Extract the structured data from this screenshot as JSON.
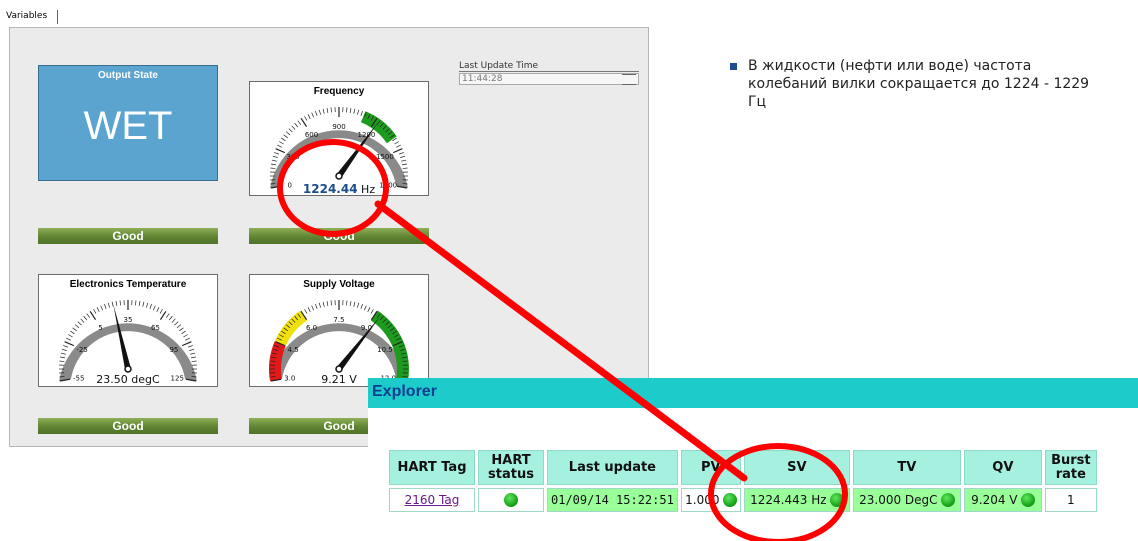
{
  "tabs": [
    {
      "label": "Variables"
    }
  ],
  "last_update": {
    "label": "Last Update Time",
    "value": "11:44:28"
  },
  "widgets": {
    "output_state": {
      "title": "Output State",
      "value": "WET",
      "status": "Good"
    },
    "frequency": {
      "title": "Frequency",
      "value": "1224.44",
      "unit": "Hz",
      "ticks": [
        "0",
        "300",
        "600",
        "900",
        "1200",
        "1500",
        "1800"
      ],
      "status": "Good",
      "range": [
        0,
        1800
      ],
      "needle_value": 1224.44
    },
    "electronics_temperature": {
      "title": "Electronics Temperature",
      "value": "23.50 degC",
      "ticks": [
        "-55",
        "-25",
        "5",
        "35",
        "65",
        "95",
        "125"
      ],
      "status": "Good",
      "range": [
        -55,
        125
      ],
      "needle_value": 23.5
    },
    "supply_voltage": {
      "title": "Supply Voltage",
      "value": "9.21 V",
      "ticks": [
        "3.0",
        "4.5",
        "6.0",
        "7.5",
        "9.0",
        "10.5",
        "12.0"
      ],
      "status": "Good",
      "range": [
        3.0,
        12.0
      ],
      "needle_value": 9.21
    }
  },
  "note": {
    "text": "В жидкости (нефти или воде) частота колебаний вилки сокращается до 1224 - 1229 Гц"
  },
  "explorer": {
    "title": "Explorer",
    "headers": {
      "hart_tag": "HART Tag",
      "hart_status": "HART status",
      "last_update": "Last update",
      "pv": "PV",
      "sv": "SV",
      "tv": "TV",
      "qv": "QV",
      "burst_rate": "Burst rate"
    },
    "row": {
      "hart_tag": "2160 Tag",
      "last_update": "01/09/14 15:22:51",
      "pv": "1.000",
      "sv": "1224.443 Hz",
      "tv": "23.000 DegC",
      "qv": "9.204 V",
      "burst_rate": "1"
    }
  },
  "colors": {
    "wet_tile": "#5ba4d0",
    "good_bar": "#5f8432",
    "explorer_header": "#1ecbcb",
    "highlight": "#ff0000",
    "status_dot": "#129a12"
  },
  "icons": [
    "status-dot-icon",
    "gauge-needle-icon"
  ]
}
